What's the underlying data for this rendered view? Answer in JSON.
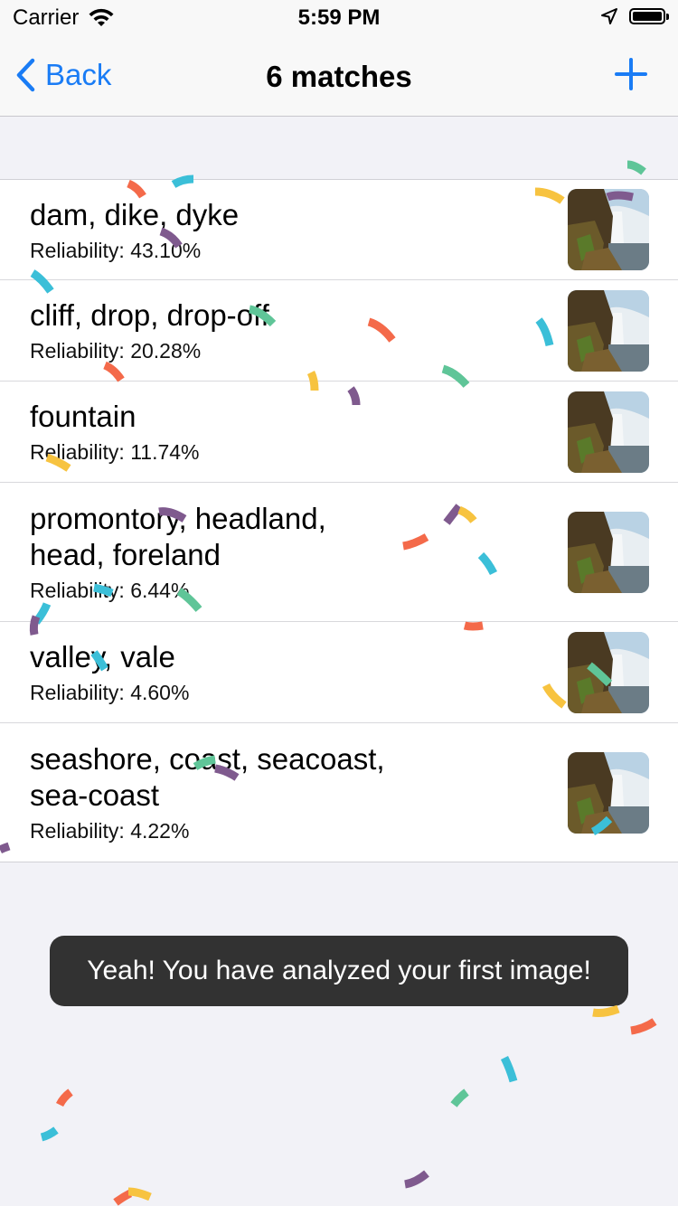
{
  "status_bar": {
    "carrier": "Carrier",
    "time": "5:59 PM",
    "icons": [
      "wifi-icon",
      "location-arrow-icon",
      "battery-icon"
    ]
  },
  "nav": {
    "back_label": "Back",
    "title": "6 matches",
    "add_icon": "plus-icon",
    "accent": "#1a7cf5"
  },
  "results": [
    {
      "title": "dam, dike, dyke",
      "reliability": "Reliability: 43.10%"
    },
    {
      "title": "cliff, drop, drop-off",
      "reliability": "Reliability: 20.28%"
    },
    {
      "title": "fountain",
      "reliability": "Reliability: 11.74%"
    },
    {
      "title": "promontory, headland, head, foreland",
      "reliability": "Reliability: 6.44%"
    },
    {
      "title": "valley, vale",
      "reliability": "Reliability: 4.60%"
    },
    {
      "title": "seashore, coast, seacoast, sea-coast",
      "reliability": "Reliability: 4.22%"
    }
  ],
  "toast": {
    "message": "Yeah! You have analyzed your first image!"
  },
  "colors": {
    "confetti": [
      "#f46a4a",
      "#3bbfd8",
      "#7f5a8e",
      "#f7c340",
      "#5fc598"
    ]
  }
}
